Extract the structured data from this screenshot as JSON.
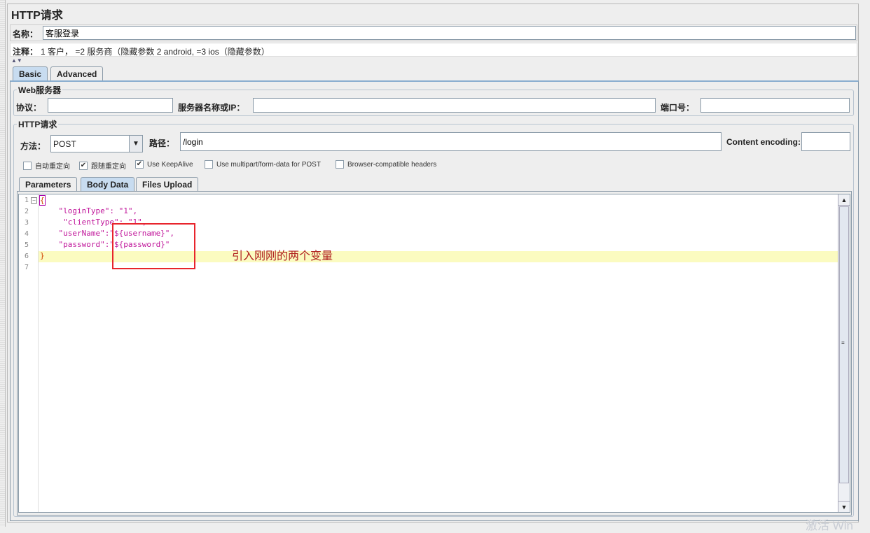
{
  "title": "HTTP请求",
  "name": {
    "label": "名称：",
    "value": "客服登录"
  },
  "comment": {
    "label": "注释：",
    "value": "1 客户， =2 服务商（隐藏参数 2 android, =3 ios（隐藏参数）"
  },
  "tabs": [
    {
      "label": "Basic",
      "active": true
    },
    {
      "label": "Advanced",
      "active": false
    }
  ],
  "web_server": {
    "legend": "Web服务器",
    "protocol_label": "协议：",
    "protocol": "",
    "server_label": "服务器名称或IP：",
    "server": "",
    "port_label": "端口号：",
    "port": ""
  },
  "http_request": {
    "legend": "HTTP请求",
    "method_label": "方法：",
    "method": "POST",
    "path_label": "路径：",
    "path": "/login",
    "encoding_label": "Content encoding:",
    "encoding": ""
  },
  "checkboxes": [
    {
      "label": "自动重定向",
      "checked": false
    },
    {
      "label": "跟随重定向",
      "checked": true
    },
    {
      "label": "Use KeepAlive",
      "checked": true
    },
    {
      "label": "Use multipart/form-data for POST",
      "checked": false
    },
    {
      "label": "Browser-compatible headers",
      "checked": false
    }
  ],
  "body_tabs": [
    {
      "label": "Parameters"
    },
    {
      "label": "Body Data",
      "active": true
    },
    {
      "label": "Files Upload"
    }
  ],
  "code_lines": [
    "{",
    "    \"loginType\": \"1\",",
    "     \"clientType\": \"1\",",
    "    \"userName\":\"${username}\",",
    "    \"password\":\"${password}\"",
    "}",
    ""
  ],
  "line_numbers": [
    "1",
    "2",
    "3",
    "4",
    "5",
    "6",
    "7"
  ],
  "annotation": "引入刚刚的两个变量",
  "watermark": "激活 Win"
}
